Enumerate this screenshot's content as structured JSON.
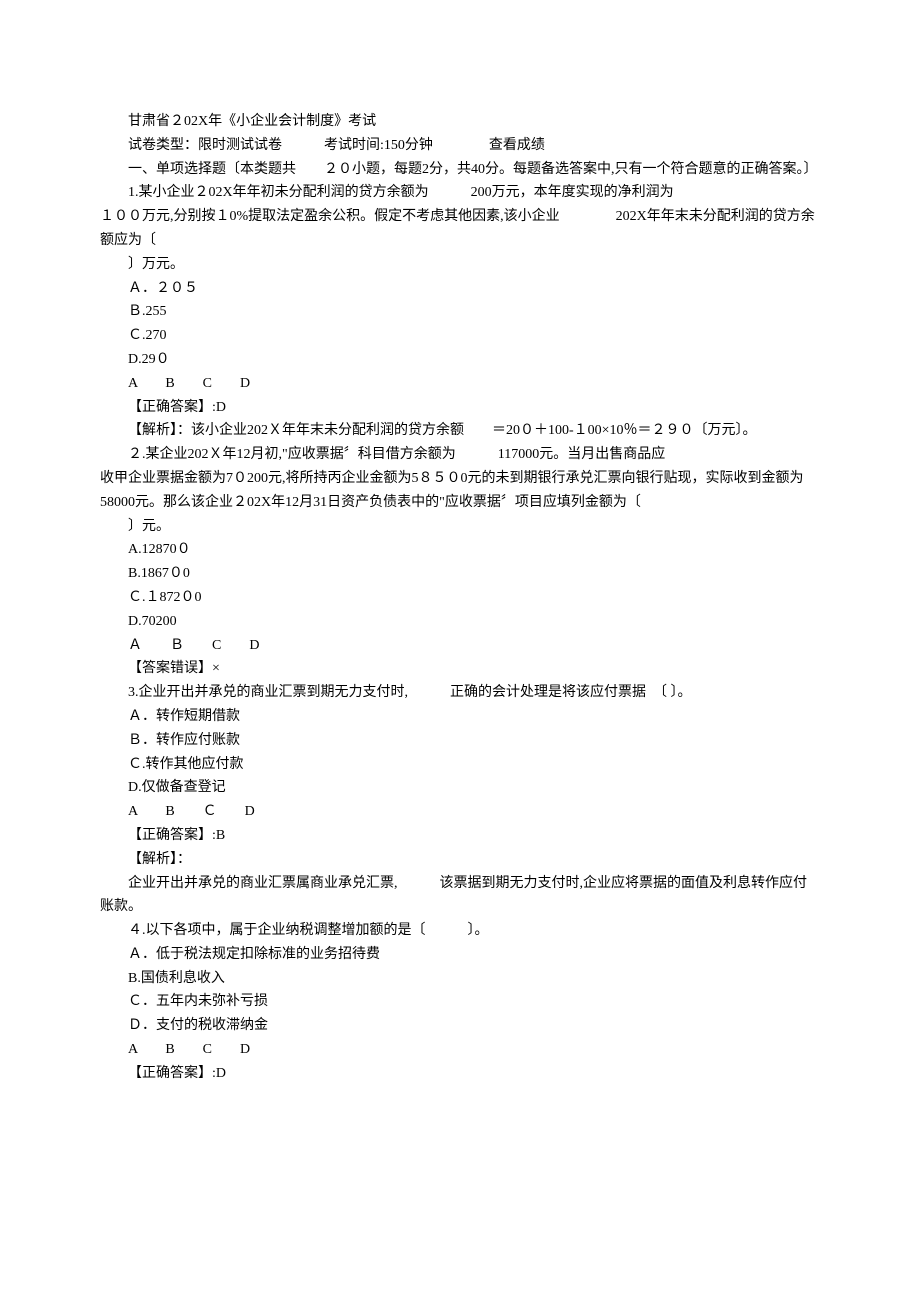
{
  "header": {
    "title": "甘肃省２02X年《小企业会计制度》考试",
    "meta_line": "试卷类型：限时测试试卷　　　考试时间:150分钟　　　　查看成绩",
    "section_title": "一、单项选择题〔本类题共　　２０小题，每题2分，共40分。每题备选答案中,只有一个符合题意的正确答案。〕"
  },
  "q1": {
    "stem_part1": "1.某小企业２02X年年初未分配利润的贷方余额为　　　200万元，本年度实现的净利润为",
    "stem_part2": "１００万元,分别按１0%提取法定盈余公积。假定不考虑其他因素,该小企业　　　　202X年年末未分配利润的贷方余额应为〔",
    "stem_part3": "〕万元。",
    "optA": "Ａ．２０５",
    "optB": "Ｂ.255",
    "optC": "Ｃ.270",
    "optD": "D.29０",
    "choices_row": "A　　B　　C　　D",
    "answer": "【正确答案】:D",
    "explain": "【解析】：该小企业202Ｘ年年末未分配利润的贷方余额　　＝20０＋100-１00×10％＝２９０〔万元〕。"
  },
  "q2": {
    "stem_part1": "２.某企业202Ｘ年12月初,\"应收票据〞科目借方余额为　　　117000元。当月出售商品应",
    "stem_part2": "收甲企业票据金额为7０200元,将所持丙企业金额为5８５０0元的未到期银行承兑汇票向银行贴现，实际收到金额为58000元。那么该企业２02X年12月31日资产负债表中的\"应收票据〞项目应填列金额为〔",
    "stem_part3": "〕元。",
    "optA": "A.12870０",
    "optB": "B.1867０0",
    "optC": "Ｃ.１872０0",
    "optD": "D.70200",
    "choices_row": "Ａ　　Ｂ　　C　　D",
    "answer": "【答案错误】×"
  },
  "q3": {
    "stem": "3.企业开出并承兑的商业汇票到期无力支付时,　　　正确的会计处理是将该应付票据　〔 〕。",
    "optA": "Ａ．转作短期借款",
    "optB": "Ｂ．转作应付账款",
    "optC": "Ｃ.转作其他应付款",
    "optD": "D.仅做备查登记",
    "choices_row": "A　　B　　Ｃ　　D",
    "answer": "【正确答案】:B",
    "explain_label": "【解析】：",
    "explain_body": "企业开出并承兑的商业汇票属商业承兑汇票,　　　该票据到期无力支付时,企业应将票据的面值及利息转作应付账款。"
  },
  "q4": {
    "stem": "４.以下各项中，属于企业纳税调整增加额的是〔　　　〕。",
    "optA": "Ａ．低于税法规定扣除标准的业务招待费",
    "optB": "B.国债利息收入",
    "optC": "Ｃ．五年内未弥补亏损",
    "optD": "Ｄ．支付的税收滞纳金",
    "choices_row": "A　　B　　C　　D",
    "answer": "【正确答案】:D"
  }
}
